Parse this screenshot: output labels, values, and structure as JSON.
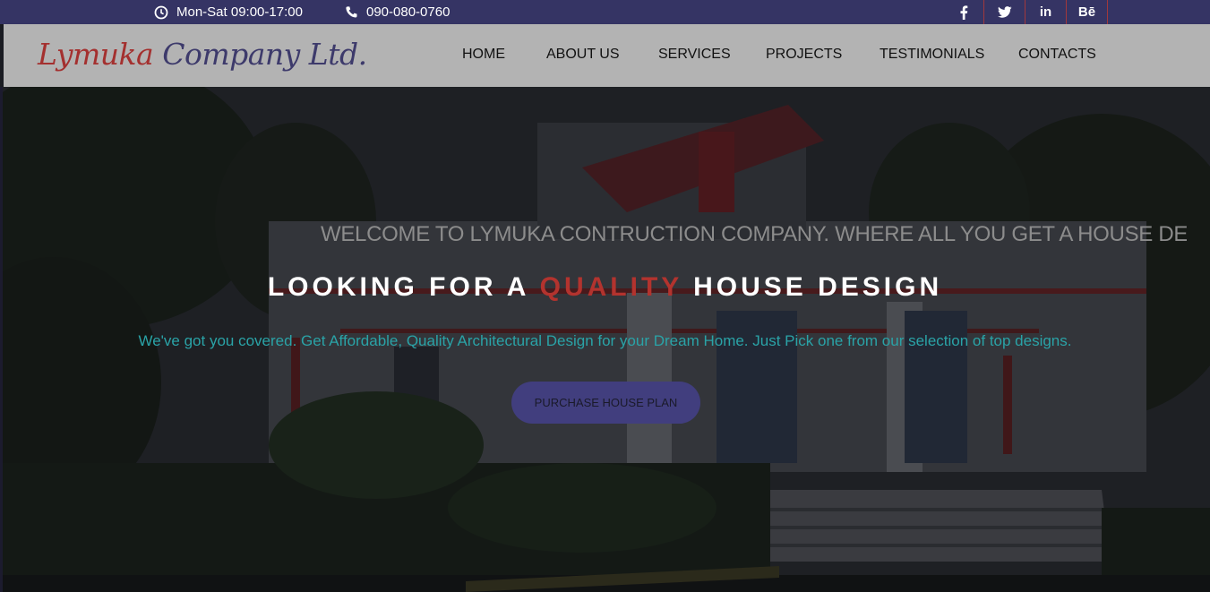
{
  "topbar": {
    "hours": "Mon-Sat 09:00-17:00",
    "hours_icon": "clock-icon",
    "phone": "090-080-0760",
    "phone_icon": "phone-icon",
    "social": [
      {
        "name": "facebook-icon",
        "glyph": "f"
      },
      {
        "name": "twitter-icon",
        "glyph": "🐦"
      },
      {
        "name": "linkedin-icon",
        "glyph": "in"
      },
      {
        "name": "behance-icon",
        "glyph": "Bē"
      }
    ],
    "bg_color": "#353464"
  },
  "header": {
    "logo_part1": "Lymuka",
    "logo_part2": "Company Ltd.",
    "nav": [
      "HOME",
      "ABOUT US",
      "SERVICES",
      "PROJECTS",
      "TESTIMONIALS",
      "CONTACTS"
    ]
  },
  "hero": {
    "marquee": "WELCOME TO LYMUKA CONTRUCTION COMPANY. WHERE ALL YOU GET A HOUSE DESIGN",
    "headline_before": "LOOKING FOR A",
    "headline_highlight": "QUALITY",
    "headline_after": "HOUSE DESIGN",
    "subline": "We've got you covered. Get Affordable, Quality Architectural Design for your Dream Home. Just Pick one from our selection of top designs.",
    "cta": "PURCHASE HOUSE PLAN",
    "accent_color": "#b3332e",
    "sub_color": "#2aa3a7"
  }
}
